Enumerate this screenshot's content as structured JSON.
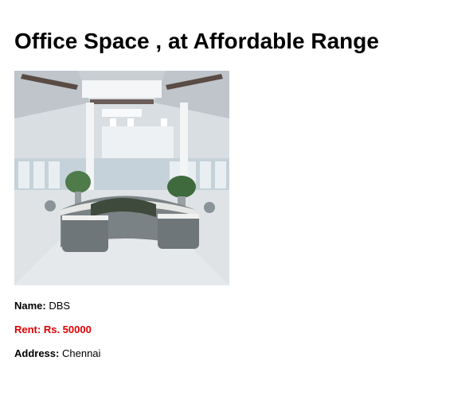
{
  "listing": {
    "title": "Office Space , at Affordable Range",
    "name_label": "Name:",
    "name_value": "DBS",
    "rent_text": "Rent: Rs. 50000",
    "address_label": "Address:",
    "address_value": "Chennai"
  }
}
